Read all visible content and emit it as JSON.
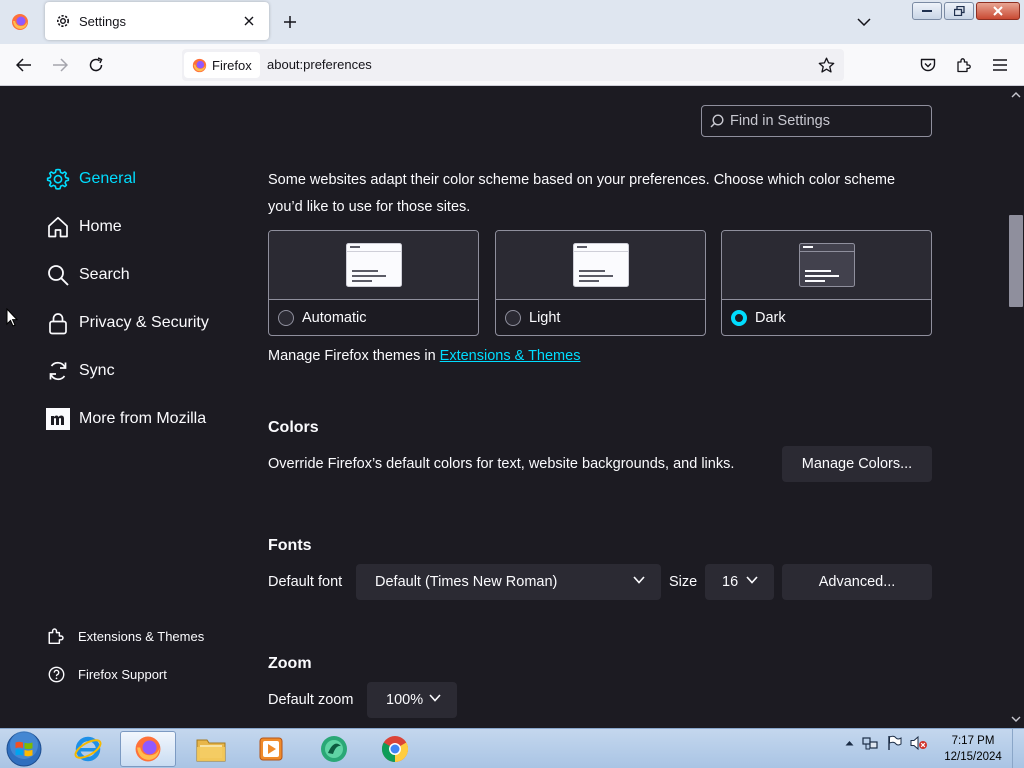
{
  "browser": {
    "tab_title": "Settings",
    "identity_label": "Firefox",
    "url": "about:preferences"
  },
  "sidebar": {
    "items": [
      {
        "label": "General",
        "icon": "gear-icon",
        "selected": true
      },
      {
        "label": "Home",
        "icon": "home-icon",
        "selected": false
      },
      {
        "label": "Search",
        "icon": "search-icon",
        "selected": false
      },
      {
        "label": "Privacy & Security",
        "icon": "lock-icon",
        "selected": false
      },
      {
        "label": "Sync",
        "icon": "sync-icon",
        "selected": false
      },
      {
        "label": "More from Mozilla",
        "icon": "mozilla-m-icon",
        "selected": false
      }
    ],
    "footer": [
      {
        "label": "Extensions & Themes",
        "icon": "puzzle-icon"
      },
      {
        "label": "Firefox Support",
        "icon": "help-icon"
      }
    ]
  },
  "search": {
    "placeholder": "Find in Settings"
  },
  "color_scheme": {
    "description": "Some websites adapt their color scheme based on your preferences. Choose which color scheme you’d like to use for those sites.",
    "options": [
      {
        "label": "Automatic",
        "checked": false
      },
      {
        "label": "Light",
        "checked": false
      },
      {
        "label": "Dark",
        "checked": true
      }
    ],
    "manage_prefix": "Manage Firefox themes in",
    "manage_link": "Extensions & Themes"
  },
  "colors": {
    "title": "Colors",
    "description": "Override Firefox’s default colors for text, website backgrounds, and links.",
    "button": "Manage Colors..."
  },
  "fonts": {
    "title": "Fonts",
    "default_font_label": "Default font",
    "default_font_value": "Default (Times New Roman)",
    "size_label": "Size",
    "size_value": "16",
    "advanced_button": "Advanced..."
  },
  "zoom": {
    "title": "Zoom",
    "default_zoom_label": "Default zoom",
    "default_zoom_value": "100%"
  },
  "taskbar": {
    "time": "7:17 PM",
    "date": "12/15/2024"
  },
  "theme_colors": {
    "background": "#1c1b22",
    "accent": "#00ddff",
    "text": "#fbfbfe",
    "control": "#2b2a33"
  }
}
